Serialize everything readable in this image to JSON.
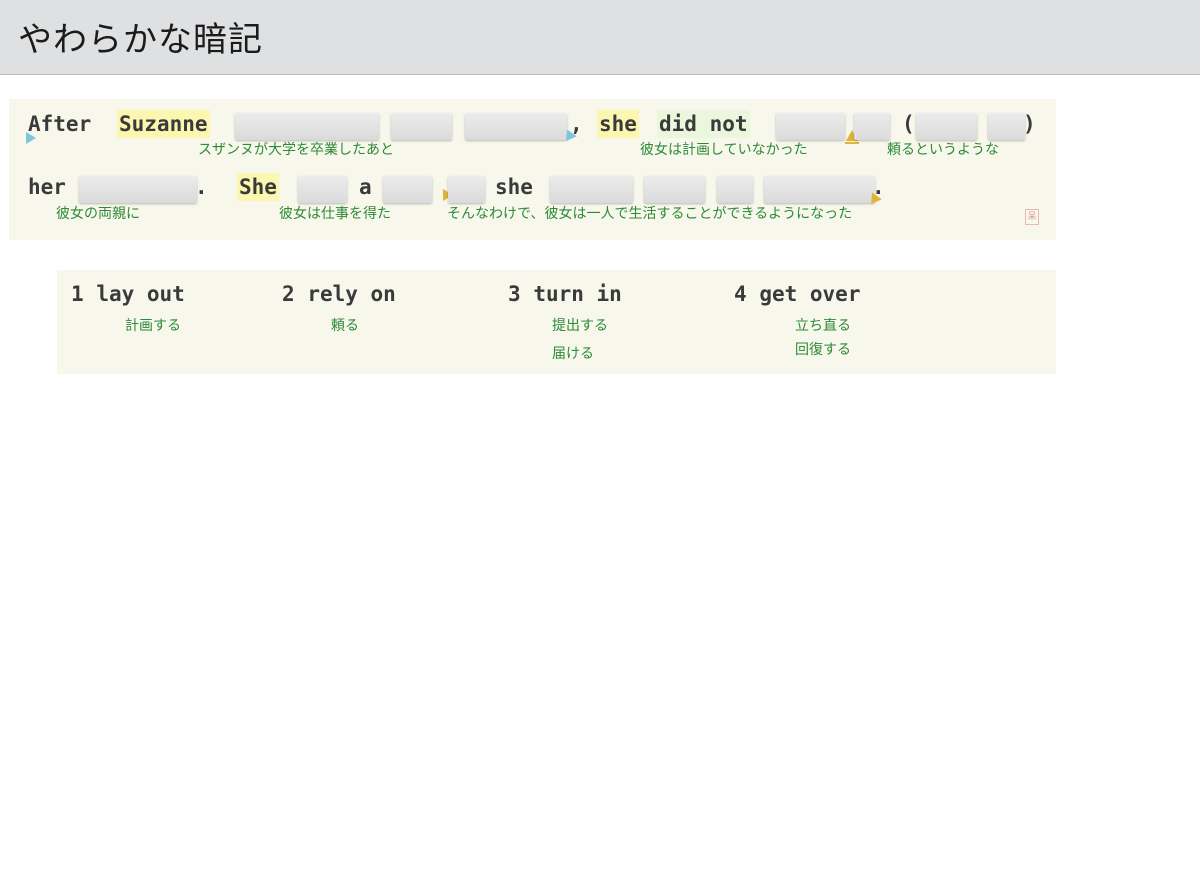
{
  "app": {
    "title": "やわらかな暗記"
  },
  "sentence": {
    "line1": {
      "word_after": "After",
      "word_suzanne": "Suzanne",
      "comma": ",",
      "word_she": "she",
      "word_did_not": "did not",
      "paren_open": "(",
      "paren_close": ")"
    },
    "line2": {
      "word_her": "her",
      "period1": ".",
      "word_She": "She",
      "word_a": "a",
      "word_she2": "she",
      "period2": "."
    },
    "glosses": {
      "g1": "スザンヌが大学を卒業したあと",
      "g2": "彼女は計画していなかった",
      "g3": "頼るというような",
      "g4": "彼女の両親に",
      "g5": "彼女は仕事を得た",
      "g6": "そんなわけで、彼女は一人で生活することができるようになった"
    },
    "stamp": "呆"
  },
  "choices": [
    {
      "num": "1",
      "phrase": "lay out",
      "meanings": [
        "計画する"
      ]
    },
    {
      "num": "2",
      "phrase": "rely on",
      "meanings": [
        "頼る"
      ]
    },
    {
      "num": "3",
      "phrase": "turn in",
      "meanings": [
        "提出する",
        "届ける"
      ]
    },
    {
      "num": "4",
      "phrase": "get over",
      "meanings": [
        "立ち直る",
        "回復する"
      ]
    }
  ]
}
